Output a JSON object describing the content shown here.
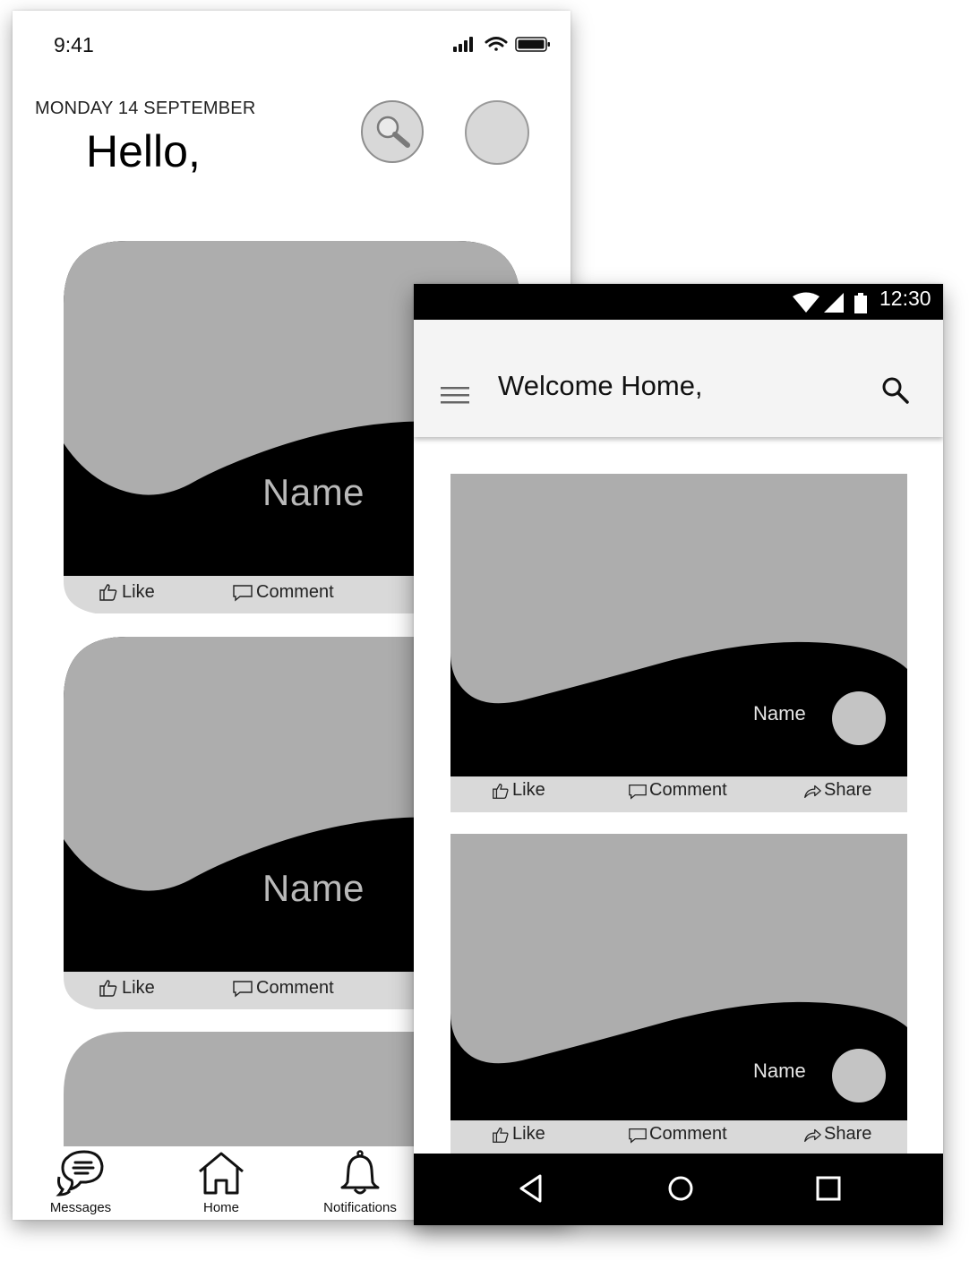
{
  "ios": {
    "status_time": "9:41",
    "date": "MONDAY 14 SEPTEMBER",
    "greeting": "Hello,",
    "cards": [
      {
        "name": "Name",
        "like": "Like",
        "comment": "Comment"
      },
      {
        "name": "Name",
        "like": "Like",
        "comment": "Comment"
      }
    ],
    "tabs": [
      {
        "label": "Messages",
        "icon": "chat-bubble-icon"
      },
      {
        "label": "Home",
        "icon": "home-icon"
      },
      {
        "label": "Notifications",
        "icon": "bell-icon"
      }
    ]
  },
  "android": {
    "status_time": "12:30",
    "title": "Welcome Home,",
    "cards": [
      {
        "name": "Name",
        "like": "Like",
        "comment": "Comment",
        "share": "Share"
      },
      {
        "name": "Name",
        "like": "Like",
        "comment": "Comment",
        "share": "Share"
      }
    ],
    "nav": [
      "back-icon",
      "home-circle-icon",
      "recents-square-icon"
    ]
  },
  "colors": {
    "placeholder_gray": "#adadad",
    "action_bar_gray": "#d9d9d9",
    "black": "#000000",
    "appbar": "#f4f4f4"
  }
}
